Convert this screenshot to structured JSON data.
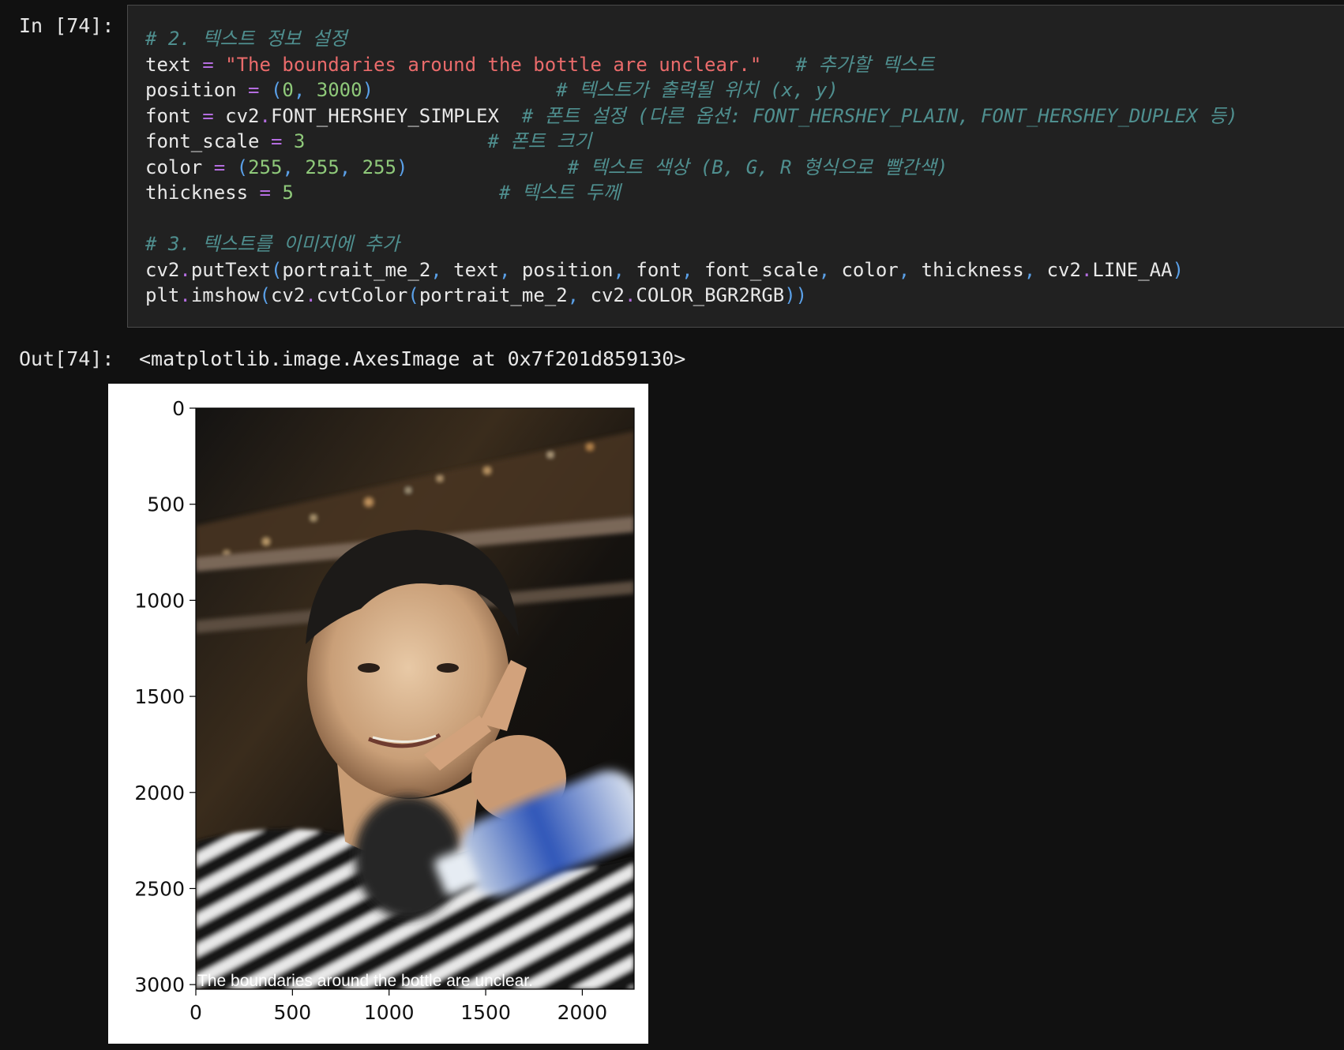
{
  "prompts": {
    "in": "In [74]:",
    "out": "Out[74]:"
  },
  "code_lines": [
    [
      [
        "t-cm",
        "# 2. 텍스트 정보 설정"
      ]
    ],
    [
      [
        "t-vr",
        "text "
      ],
      [
        "t-op",
        "="
      ],
      [
        "t-vr",
        " "
      ],
      [
        "t-st",
        "\"The boundaries around the bottle are unclear.\""
      ],
      [
        "t-vr",
        "   "
      ],
      [
        "t-cm",
        "# 추가할 텍스트"
      ]
    ],
    [
      [
        "t-vr",
        "position "
      ],
      [
        "t-op",
        "="
      ],
      [
        "t-vr",
        " "
      ],
      [
        "t-pa",
        "("
      ],
      [
        "t-nu",
        "0"
      ],
      [
        "t-pa",
        ", "
      ],
      [
        "t-nu",
        "3000"
      ],
      [
        "t-pa",
        ")"
      ],
      [
        "t-vr",
        "                "
      ],
      [
        "t-cm",
        "# 텍스트가 출력될 위치 (x, y)"
      ]
    ],
    [
      [
        "t-vr",
        "font "
      ],
      [
        "t-op",
        "="
      ],
      [
        "t-vr",
        " cv2"
      ],
      [
        "t-op",
        "."
      ],
      [
        "t-vr",
        "FONT_HERSHEY_SIMPLEX  "
      ],
      [
        "t-cm",
        "# 폰트 설정 (다른 옵션: FONT_HERSHEY_PLAIN, FONT_HERSHEY_DUPLEX 등)"
      ]
    ],
    [
      [
        "t-vr",
        "font_scale "
      ],
      [
        "t-op",
        "="
      ],
      [
        "t-vr",
        " "
      ],
      [
        "t-nu",
        "3"
      ],
      [
        "t-vr",
        "                "
      ],
      [
        "t-cm",
        "# 폰트 크기"
      ]
    ],
    [
      [
        "t-vr",
        "color "
      ],
      [
        "t-op",
        "="
      ],
      [
        "t-vr",
        " "
      ],
      [
        "t-pa",
        "("
      ],
      [
        "t-nu",
        "255"
      ],
      [
        "t-pa",
        ", "
      ],
      [
        "t-nu",
        "255"
      ],
      [
        "t-pa",
        ", "
      ],
      [
        "t-nu",
        "255"
      ],
      [
        "t-pa",
        ")"
      ],
      [
        "t-vr",
        "              "
      ],
      [
        "t-cm",
        "# 텍스트 색상 (B, G, R 형식으로 빨간색)"
      ]
    ],
    [
      [
        "t-vr",
        "thickness "
      ],
      [
        "t-op",
        "="
      ],
      [
        "t-vr",
        " "
      ],
      [
        "t-nu",
        "5"
      ],
      [
        "t-vr",
        "                  "
      ],
      [
        "t-cm",
        "# 텍스트 두께"
      ]
    ],
    [
      [
        "t-vr",
        ""
      ]
    ],
    [
      [
        "t-cm",
        "# 3. 텍스트를 이미지에 추가"
      ]
    ],
    [
      [
        "t-vr",
        "cv2"
      ],
      [
        "t-op",
        "."
      ],
      [
        "t-vr",
        "putText"
      ],
      [
        "t-pa",
        "("
      ],
      [
        "t-vr",
        "portrait_me_2"
      ],
      [
        "t-pa",
        ", "
      ],
      [
        "t-vr",
        "text"
      ],
      [
        "t-pa",
        ", "
      ],
      [
        "t-vr",
        "position"
      ],
      [
        "t-pa",
        ", "
      ],
      [
        "t-vr",
        "font"
      ],
      [
        "t-pa",
        ", "
      ],
      [
        "t-vr",
        "font_scale"
      ],
      [
        "t-pa",
        ", "
      ],
      [
        "t-vr",
        "color"
      ],
      [
        "t-pa",
        ", "
      ],
      [
        "t-vr",
        "thickness"
      ],
      [
        "t-pa",
        ", "
      ],
      [
        "t-vr",
        "cv2"
      ],
      [
        "t-op",
        "."
      ],
      [
        "t-vr",
        "LINE_AA"
      ],
      [
        "t-pa",
        ")"
      ]
    ],
    [
      [
        "t-vr",
        "plt"
      ],
      [
        "t-op",
        "."
      ],
      [
        "t-vr",
        "imshow"
      ],
      [
        "t-pa",
        "("
      ],
      [
        "t-vr",
        "cv2"
      ],
      [
        "t-op",
        "."
      ],
      [
        "t-vr",
        "cvtColor"
      ],
      [
        "t-pa",
        "("
      ],
      [
        "t-vr",
        "portrait_me_2"
      ],
      [
        "t-pa",
        ", "
      ],
      [
        "t-vr",
        "cv2"
      ],
      [
        "t-op",
        "."
      ],
      [
        "t-vr",
        "COLOR_BGR2RGB"
      ],
      [
        "t-pa",
        "))"
      ]
    ]
  ],
  "output_repr": "<matplotlib.image.AxesImage at 0x7f201d859130>",
  "figure": {
    "image_caption": "The boundaries around the bottle are unclear.",
    "image_description_icon": "portrait-photo",
    "chart_data": {
      "type": "image",
      "xlim": [
        0,
        2268
      ],
      "ylim": [
        3024,
        0
      ],
      "xticks": [
        0,
        500,
        1000,
        1500,
        2000
      ],
      "yticks": [
        0,
        500,
        1000,
        1500,
        2000,
        2500,
        3000
      ],
      "xtick_labels": [
        "0",
        "500",
        "1000",
        "1500",
        "2000"
      ],
      "ytick_labels": [
        "0",
        "500",
        "1000",
        "1500",
        "2000",
        "2500",
        "3000"
      ],
      "title": "",
      "xlabel": "",
      "ylabel": ""
    }
  },
  "colors": {
    "background": "#111111",
    "cell_background": "#212121",
    "comment": "#4f8f8f",
    "string": "#ea6b6b",
    "operator": "#b46ddf",
    "number": "#8fc97a",
    "paren": "#5aa0e8"
  }
}
